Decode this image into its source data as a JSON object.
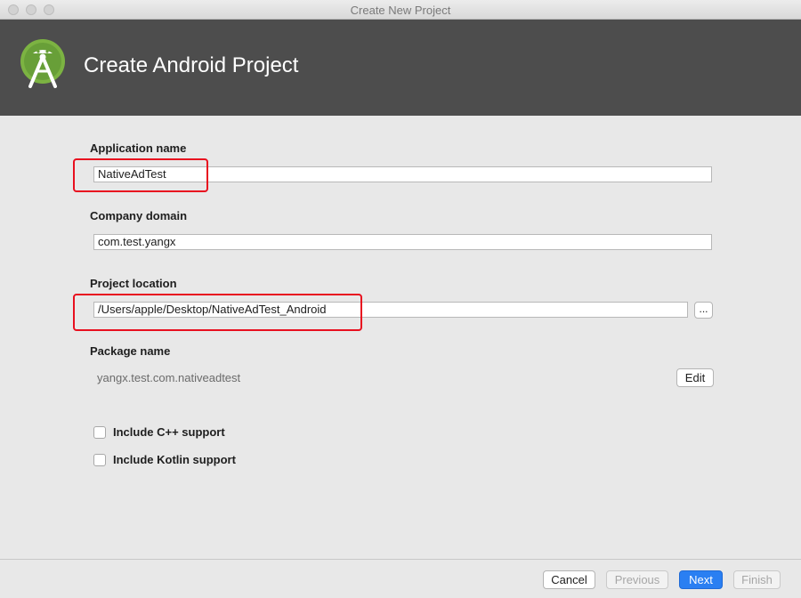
{
  "window": {
    "title": "Create New Project"
  },
  "header": {
    "title": "Create Android Project",
    "logo_icon": "android-studio-logo-icon"
  },
  "form": {
    "application_name": {
      "label": "Application name",
      "value": "NativeAdTest"
    },
    "company_domain": {
      "label": "Company domain",
      "value": "com.test.yangx"
    },
    "project_location": {
      "label": "Project location",
      "value": "/Users/apple/Desktop/NativeAdTest_Android",
      "browse_label": "..."
    },
    "package_name": {
      "label": "Package name",
      "value": "yangx.test.com.nativeadtest",
      "edit_label": "Edit"
    },
    "options": [
      {
        "label": "Include C++ support",
        "checked": false
      },
      {
        "label": "Include Kotlin support",
        "checked": false
      }
    ]
  },
  "footer": {
    "cancel_label": "Cancel",
    "previous_label": "Previous",
    "next_label": "Next",
    "finish_label": "Finish"
  },
  "colors": {
    "header_bg": "#4d4d4d",
    "highlight": "#e8101f",
    "primary_button": "#2a7ff2",
    "logo_green": "#7cb342"
  }
}
